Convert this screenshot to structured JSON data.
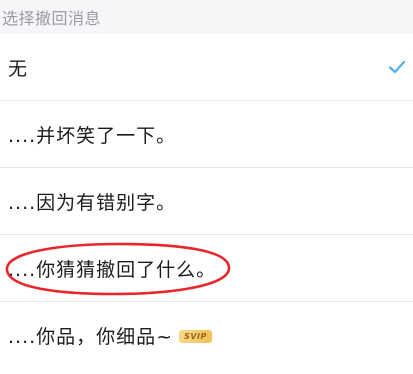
{
  "header": {
    "title": "选择撤回消息"
  },
  "options": [
    {
      "label": "无",
      "selected": true
    },
    {
      "label": "....并坏笑了一下。",
      "selected": false
    },
    {
      "label": "....因为有错别字。",
      "selected": false
    },
    {
      "label": "....你猜猜撤回了什么。",
      "selected": false,
      "annotated": true
    },
    {
      "label": "....你品，你细品~",
      "selected": false,
      "badge": "SVIP"
    }
  ],
  "colors": {
    "check": "#4fb3e8",
    "annotation": "#e8262b",
    "header_bg": "#f5f6f8"
  },
  "icons": {
    "check": "check-icon"
  }
}
